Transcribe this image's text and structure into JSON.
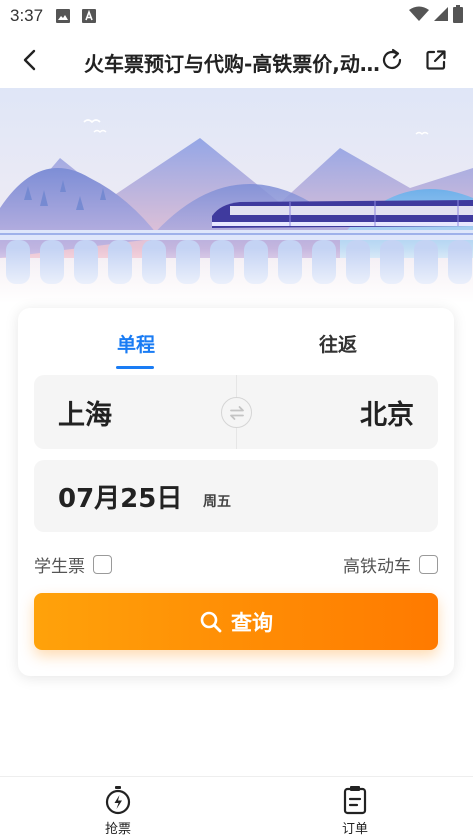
{
  "status_bar": {
    "time": "3:37",
    "icons": [
      "image-icon",
      "font-a-icon",
      "wifi-icon",
      "signal-icon",
      "battery-icon"
    ]
  },
  "header": {
    "title": "火车票预订与代购-高铁票价,动...",
    "back_icon": "chevron-left-icon",
    "refresh_icon": "refresh-icon",
    "share_icon": "share-external-icon"
  },
  "tabs": [
    {
      "label": "单程",
      "active": true
    },
    {
      "label": "往返",
      "active": false
    }
  ],
  "route": {
    "from": "上海",
    "to": "北京",
    "swap_icon": "swap-arrows-icon"
  },
  "date": {
    "value": "07月25日",
    "weekday": "周五"
  },
  "options": {
    "student": {
      "label": "学生票",
      "checked": false
    },
    "highspeed": {
      "label": "高铁动车",
      "checked": false
    }
  },
  "search": {
    "label": "查询",
    "icon": "search-icon"
  },
  "bottom_nav": [
    {
      "label": "抢票",
      "icon": "stopwatch-bolt-icon"
    },
    {
      "label": "订单",
      "icon": "order-clipboard-icon"
    }
  ],
  "colors": {
    "accent": "#1a7cf4",
    "button_start": "#ffa20a",
    "button_end": "#ff7a00"
  }
}
